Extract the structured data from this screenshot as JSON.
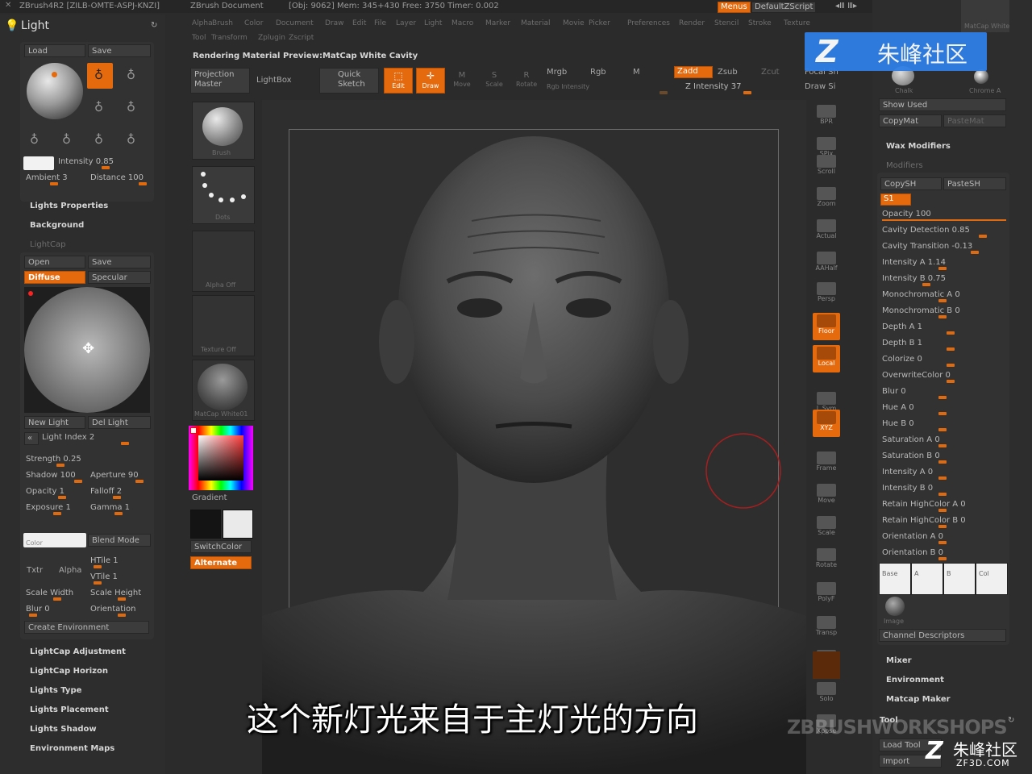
{
  "titlebar": {
    "app": "ZBrush4R2 [ZILB-OMTE-ASPJ-KNZI]",
    "doc": "ZBrush Document",
    "stats": "[Obj: 9062] Mem: 345+430 Free: 3750 Timer: 0.002",
    "menus": "Menus",
    "script": "DefaultZScript"
  },
  "menubar": [
    "Alpha",
    "Brush",
    "Color",
    "Document",
    "Draw",
    "Edit",
    "File",
    "Layer",
    "Light",
    "Macro",
    "Marker",
    "Material",
    "Movie",
    "Picker",
    "Preferences",
    "Render",
    "Stencil",
    "Stroke",
    "Texture",
    "Tool",
    "Transform",
    "Zplugin",
    "Zscript"
  ],
  "left": {
    "title": "Light",
    "load": "Load",
    "save": "Save",
    "intensity": "Intensity 0.85",
    "ambient": "Ambient 3",
    "distance": "Distance 100",
    "lights_properties": "Lights Properties",
    "background": "Background",
    "lightcap": "LightCap",
    "open": "Open",
    "save2": "Save",
    "diffuse": "Diffuse",
    "specular": "Specular",
    "new_light": "New Light",
    "del_light": "Del Light",
    "light_index": "Light Index 2",
    "strength": "Strength 0.25",
    "shadow": "Shadow 100",
    "aperture": "Aperture 90",
    "opacity": "Opacity 1",
    "falloff": "Falloff 2",
    "exposure": "Exposure 1",
    "gamma": "Gamma 1",
    "color": "Color",
    "blend_mode": "Blend Mode",
    "htile": "HTile 1",
    "vtile": "VTile 1",
    "txtr": "Txtr",
    "alpha": "Alpha",
    "scale_width": "Scale Width",
    "scale_height": "Scale Height",
    "blur": "Blur 0",
    "orientation": "Orientation",
    "create_env": "Create Environment",
    "sections": [
      "LightCap Adjustment",
      "LightCap Horizon",
      "Lights Type",
      "Lights Placement",
      "Lights Shadow",
      "Environment Maps"
    ]
  },
  "tray": {
    "brush": "Brush",
    "stroke": "Dots",
    "alpha": "Alpha Off",
    "texture": "Texture Off",
    "material": "MatCap White01",
    "gradient": "Gradient",
    "switchcolor": "SwitchColor",
    "alternate": "Alternate"
  },
  "toolbar": {
    "info": "Rendering Material Preview:MatCap White Cavity",
    "projection": "Projection Master",
    "lightbox": "LightBox",
    "quicksketch": "Quick Sketch",
    "edit": "Edit",
    "draw": "Draw",
    "move": "Move",
    "scale": "Scale",
    "rotate": "Rotate",
    "mrgb": "Mrgb",
    "rgb": "Rgb",
    "m": "M",
    "zadd": "Zadd",
    "zsub": "Zsub",
    "zcut": "Zcut",
    "z_intensity": "Z Intensity 37",
    "rgb_intensity": "Rgb Intensity",
    "focal": "Focal Sh",
    "draw_size": "Draw Si"
  },
  "rightshelf": [
    "BPR",
    "SPix",
    "Scroll",
    "Zoom",
    "Actual",
    "AAHalf",
    "Persp",
    "Floor",
    "Local",
    "L.Sym",
    "XYZ",
    "Frame",
    "Move",
    "Scale",
    "Rotate",
    "PolyF",
    "Transp",
    "Ghost",
    "Solo",
    "Xpose"
  ],
  "right": {
    "mat_thumbs": [
      "MatCap White",
      "Chalk",
      "Chrome A"
    ],
    "show_used": "Show Used",
    "copymat": "CopyMat",
    "pastemat": "PasteMat",
    "wax": "Wax Modifiers",
    "modifiers": "Modifiers",
    "copysh": "CopySH",
    "pastesh": "PasteSH",
    "s1": "S1",
    "params": [
      "Opacity 100",
      "Cavity Detection 0.85",
      "Cavity Transition -0.13",
      "Intensity A 1.14",
      "Intensity B 0.75",
      "Monochromatic A 0",
      "Monochromatic B 0",
      "Depth A 1",
      "Depth B 1",
      "Colorize 0",
      "OverwriteColor 0",
      "Blur 0",
      "Hue A 0",
      "Hue B 0",
      "Saturation A 0",
      "Saturation B 0",
      "Intensity A 0",
      "Intensity B 0",
      "Retain HighColor A 0",
      "Retain HighColor B 0",
      "Orientation A 0",
      "Orientation B 0"
    ],
    "swatches": [
      "Base",
      "A",
      "B",
      "Col"
    ],
    "image": "Image",
    "channel_desc": "Channel Descriptors",
    "sections": [
      "Mixer",
      "Environment",
      "Matcap Maker"
    ],
    "tool": "Tool",
    "load_tool": "Load Tool",
    "import": "Import"
  },
  "overlay": {
    "logo_text": "朱峰社区",
    "subtitle": "这个新灯光来自于主灯光的方向",
    "watermark": "ZBRUSHWORKSHOPS",
    "corner_logo": "朱峰社区",
    "corner_url": "ZF3D.COM"
  }
}
